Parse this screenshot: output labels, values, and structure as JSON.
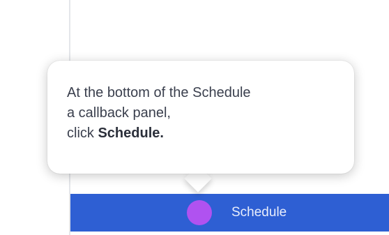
{
  "tooltip": {
    "line1": "At the bottom of the Schedule",
    "line2": "a callback panel,",
    "line3_prefix": "click ",
    "line3_bold": "Schedule."
  },
  "bottom_bar": {
    "button_label": "Schedule",
    "button_icon": "record-dot-icon",
    "colors": {
      "bar": "#2e5fd3",
      "dot": "#b052f0"
    }
  }
}
